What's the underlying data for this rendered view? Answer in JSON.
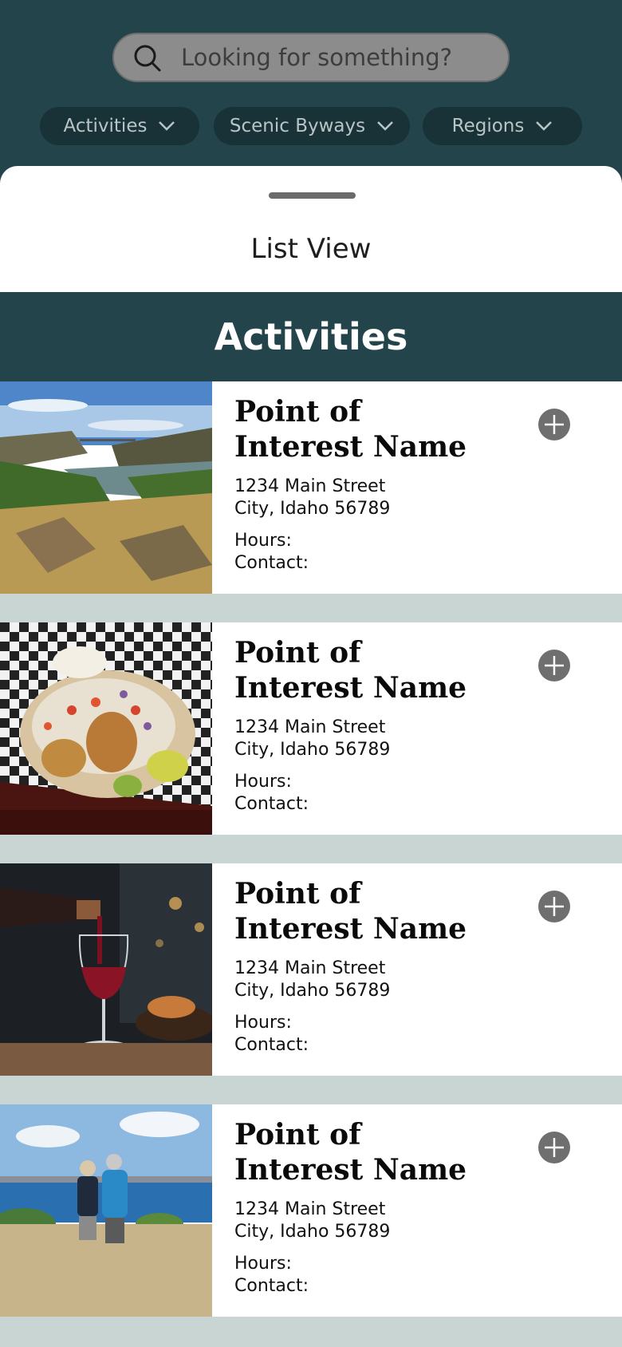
{
  "search": {
    "placeholder": "Looking for something?",
    "icon": "search-icon"
  },
  "filters": [
    {
      "label": "Activities",
      "icon": "chevron-down-icon"
    },
    {
      "label": "Scenic Byways",
      "icon": "chevron-down-icon"
    },
    {
      "label": "Regions",
      "icon": "chevron-down-icon"
    }
  ],
  "sheet": {
    "title": "List View"
  },
  "section": {
    "title": "Activities"
  },
  "items": [
    {
      "name": "Point of Interest Name",
      "address_line1": "1234 Main Street",
      "address_line2": "City, Idaho 56789",
      "hours_label": "Hours:",
      "contact_label": "Contact:",
      "image": "canyon river landscape"
    },
    {
      "name": "Point of Interest Name",
      "address_line1": "1234 Main Street",
      "address_line2": "City, Idaho 56789",
      "hours_label": "Hours:",
      "contact_label": "Contact:",
      "image": "fish tacos in checkered basket"
    },
    {
      "name": "Point of Interest Name",
      "address_line1": "1234 Main Street",
      "address_line2": "City, Idaho 56789",
      "hours_label": "Hours:",
      "contact_label": "Contact:",
      "image": "red wine being poured"
    },
    {
      "name": "Point of Interest Name",
      "address_line1": "1234 Main Street",
      "address_line2": "City, Idaho 56789",
      "hours_label": "Hours:",
      "contact_label": "Contact:",
      "image": "couple walking near lake"
    }
  ],
  "colors": {
    "header_bg": "#22444a",
    "chip_bg": "#183237",
    "page_bg": "#c9d5d3",
    "add_button": "#6f6f6f"
  }
}
